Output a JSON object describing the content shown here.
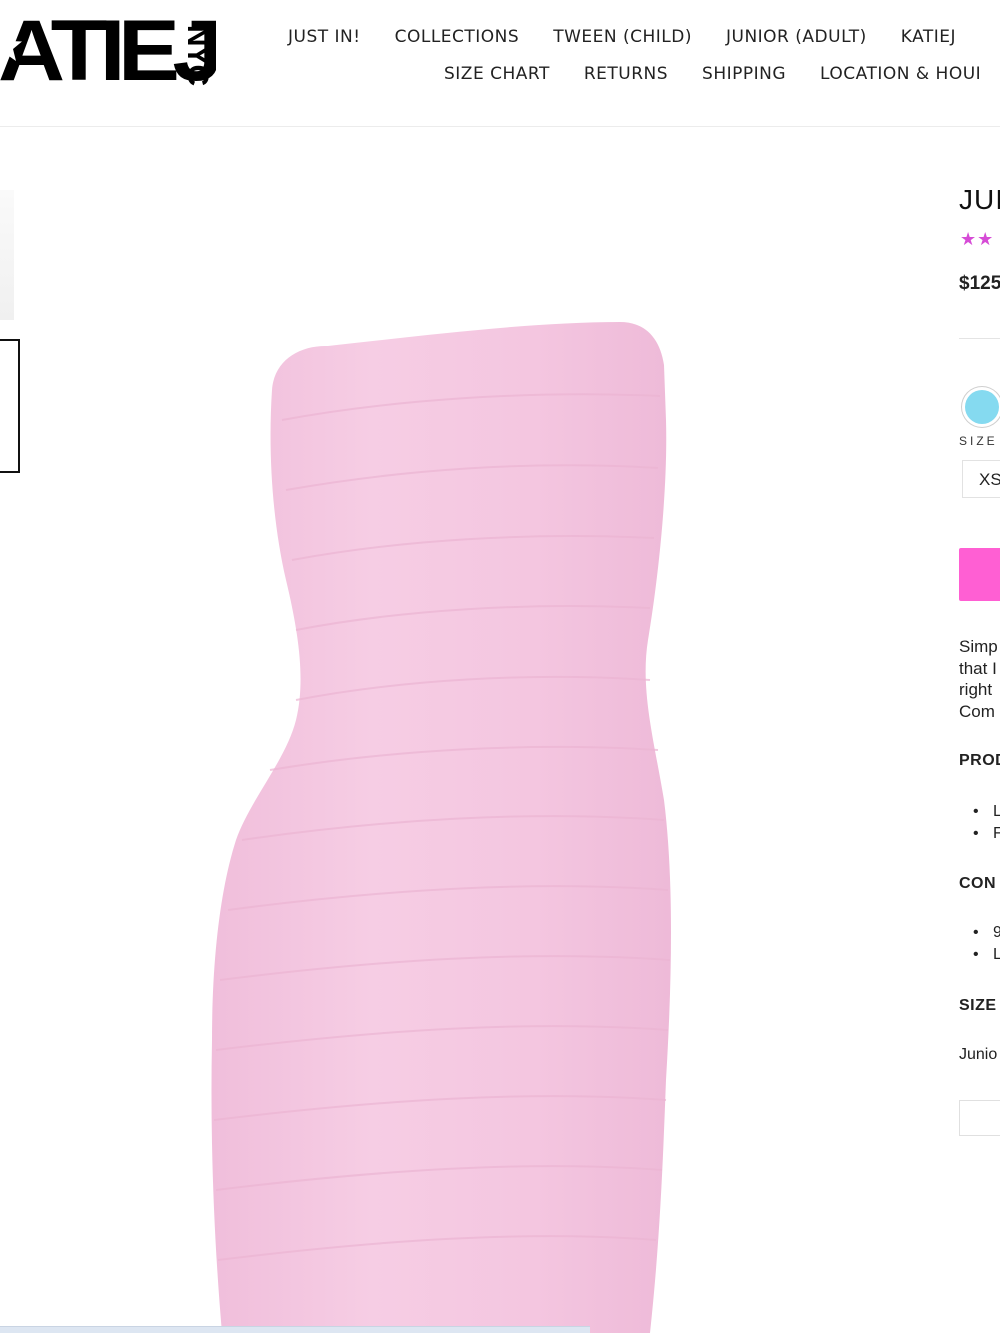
{
  "brand": {
    "logo_main": "ATIEJ",
    "logo_sub": "NYC"
  },
  "nav": {
    "row1": [
      "JUST IN!",
      "COLLECTIONS",
      "TWEEN (CHILD)",
      "JUNIOR (ADULT)",
      "KATIEJ"
    ],
    "row2": [
      "SIZE CHART",
      "RETURNS",
      "SHIPPING",
      "LOCATION & HOUI"
    ]
  },
  "product": {
    "title": "JUI",
    "stars": "★★",
    "price": "$125",
    "swatch_color": "#85daf0",
    "size_label": "SIZE",
    "selected_size": "XS",
    "add_button_color": "#ff5fd3",
    "description_lines": [
      "Simp",
      "that I",
      "right",
      "Com"
    ],
    "sections": {
      "product_head": "PROD",
      "product_bullets": [
        "L",
        "F"
      ],
      "content_head": "CON",
      "content_bullets": [
        "9",
        "L"
      ],
      "size_head": "SIZE",
      "size_text": "Junio"
    },
    "image_color": "#f4c6e0"
  }
}
